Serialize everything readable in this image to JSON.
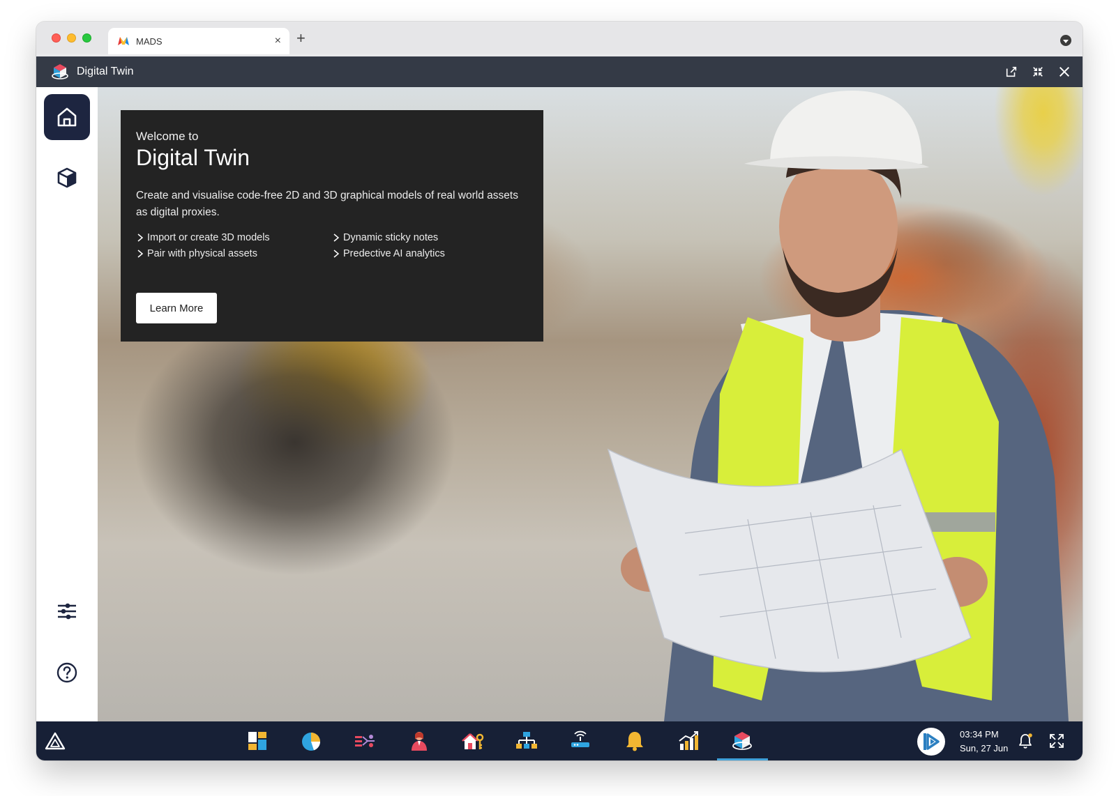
{
  "browser": {
    "tab_title": "MADS",
    "tab_close": "×",
    "new_tab": "+"
  },
  "app": {
    "title": "Digital Twin"
  },
  "sidebar": {
    "top_items": [
      {
        "name": "home",
        "icon": "home-icon",
        "active": true
      },
      {
        "name": "models",
        "icon": "cube-icon",
        "active": false
      }
    ],
    "bottom_items": [
      {
        "name": "settings",
        "icon": "sliders-icon"
      },
      {
        "name": "help",
        "icon": "question-circle-icon"
      }
    ]
  },
  "welcome": {
    "pre_title": "Welcome to",
    "title": "Digital Twin",
    "description": "Create and visualise code-free 2D and 3D graphical models of real world assets as digital proxies.",
    "features": [
      "Import or create 3D models",
      "Dynamic sticky notes",
      "Pair with physical assets",
      "Predective AI analytics"
    ],
    "cta_label": "Learn More"
  },
  "taskbar": {
    "launcher_icon": "triangle-icon",
    "dock": [
      {
        "icon": "dashboard-tiles-icon"
      },
      {
        "icon": "pie-chart-icon"
      },
      {
        "icon": "data-flow-icon"
      },
      {
        "icon": "person-icon"
      },
      {
        "icon": "home-key-icon"
      },
      {
        "icon": "org-chart-icon"
      },
      {
        "icon": "router-icon"
      },
      {
        "icon": "bell-alert-icon"
      },
      {
        "icon": "growth-chart-icon"
      },
      {
        "icon": "digital-twin-icon",
        "active": true
      }
    ],
    "time": "03:34 PM",
    "date": "Sun, 27 Jun"
  },
  "colors": {
    "app_header": "#343a46",
    "sidebar_active": "#1d2540",
    "taskbar": "#172036",
    "card_bg": "#232323",
    "active_indicator": "#3fa0d8"
  }
}
